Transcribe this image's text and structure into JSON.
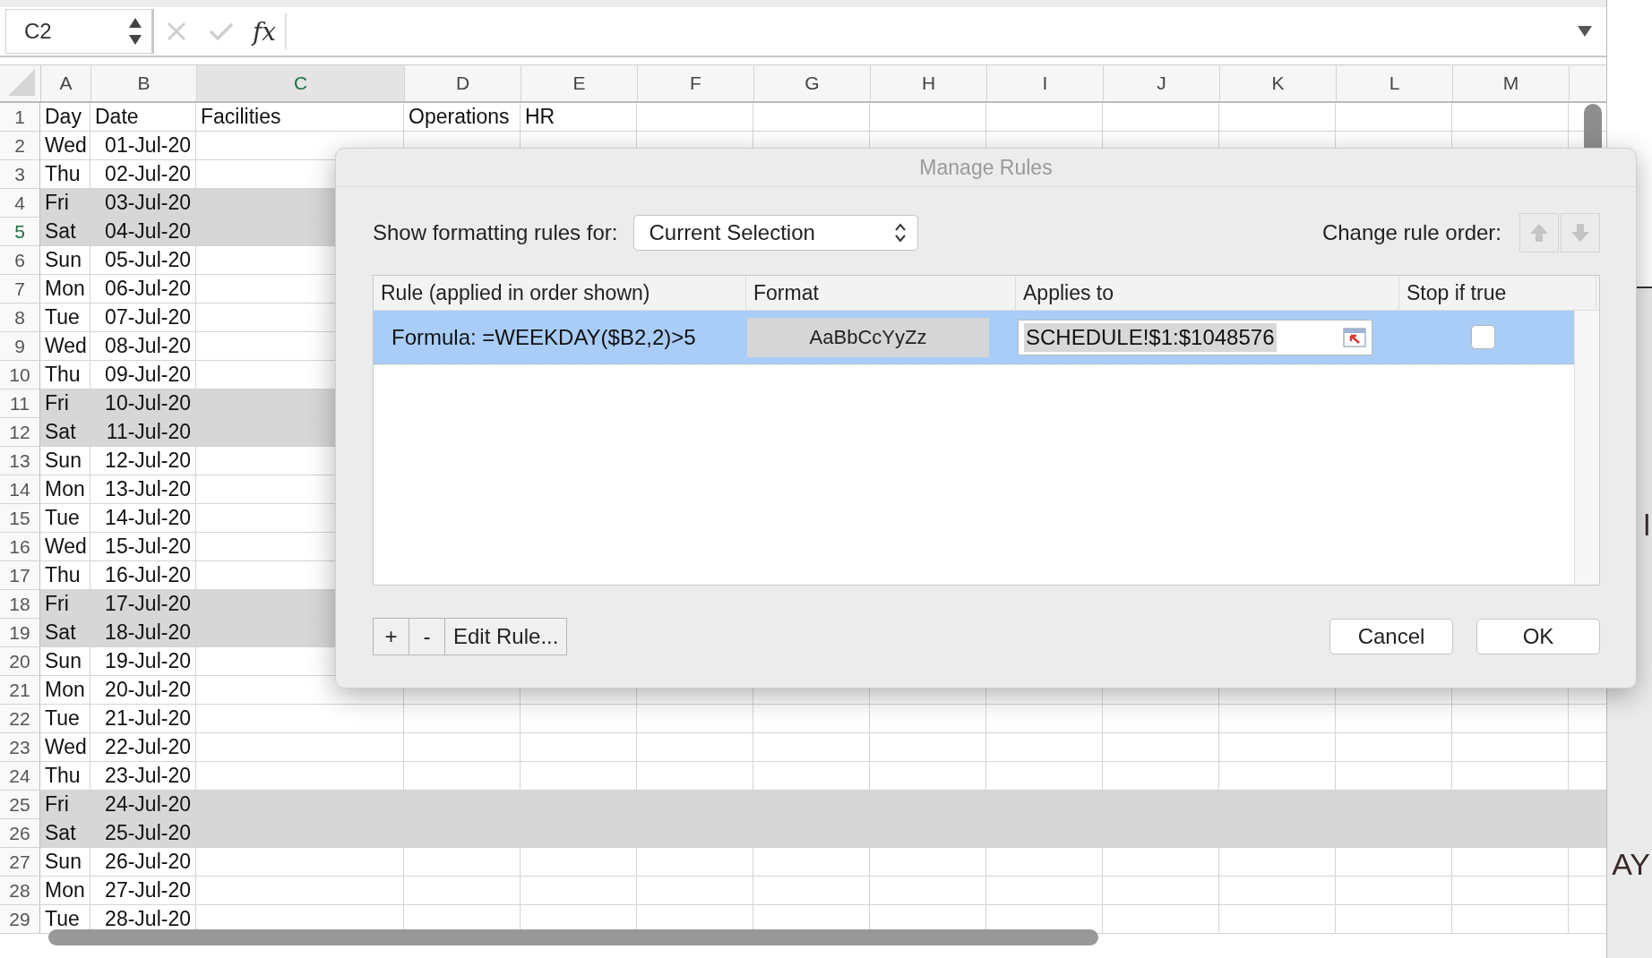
{
  "name_box": {
    "value": "C2"
  },
  "formula_bar": {
    "function_label": "fx"
  },
  "columns": [
    {
      "label": "A",
      "selected": false
    },
    {
      "label": "B",
      "selected": false
    },
    {
      "label": "C",
      "selected": true
    },
    {
      "label": "D",
      "selected": false
    },
    {
      "label": "E",
      "selected": false
    },
    {
      "label": "F",
      "selected": false
    },
    {
      "label": "G",
      "selected": false
    },
    {
      "label": "H",
      "selected": false
    },
    {
      "label": "I",
      "selected": false
    },
    {
      "label": "J",
      "selected": false
    },
    {
      "label": "K",
      "selected": false
    },
    {
      "label": "L",
      "selected": false
    },
    {
      "label": "M",
      "selected": false
    }
  ],
  "rows": [
    {
      "number": "1",
      "selected": false,
      "shaded": false,
      "cells": [
        "Day",
        "Date",
        "Facilities",
        "Operations",
        "HR"
      ]
    },
    {
      "number": "2",
      "selected": false,
      "shaded": false,
      "cells": [
        "Wed",
        "01-Jul-20"
      ]
    },
    {
      "number": "3",
      "selected": false,
      "shaded": false,
      "cells": [
        "Thu",
        "02-Jul-20"
      ]
    },
    {
      "number": "4",
      "selected": false,
      "shaded": true,
      "cells": [
        "Fri",
        "03-Jul-20"
      ]
    },
    {
      "number": "5",
      "selected": true,
      "shaded": true,
      "cells": [
        "Sat",
        "04-Jul-20"
      ]
    },
    {
      "number": "6",
      "selected": false,
      "shaded": false,
      "cells": [
        "Sun",
        "05-Jul-20"
      ]
    },
    {
      "number": "7",
      "selected": false,
      "shaded": false,
      "cells": [
        "Mon",
        "06-Jul-20"
      ]
    },
    {
      "number": "8",
      "selected": false,
      "shaded": false,
      "cells": [
        "Tue",
        "07-Jul-20"
      ]
    },
    {
      "number": "9",
      "selected": false,
      "shaded": false,
      "cells": [
        "Wed",
        "08-Jul-20"
      ]
    },
    {
      "number": "10",
      "selected": false,
      "shaded": false,
      "cells": [
        "Thu",
        "09-Jul-20"
      ]
    },
    {
      "number": "11",
      "selected": false,
      "shaded": true,
      "cells": [
        "Fri",
        "10-Jul-20"
      ]
    },
    {
      "number": "12",
      "selected": false,
      "shaded": true,
      "cells": [
        "Sat",
        "11-Jul-20"
      ]
    },
    {
      "number": "13",
      "selected": false,
      "shaded": false,
      "cells": [
        "Sun",
        "12-Jul-20"
      ]
    },
    {
      "number": "14",
      "selected": false,
      "shaded": false,
      "cells": [
        "Mon",
        "13-Jul-20"
      ]
    },
    {
      "number": "15",
      "selected": false,
      "shaded": false,
      "cells": [
        "Tue",
        "14-Jul-20"
      ]
    },
    {
      "number": "16",
      "selected": false,
      "shaded": false,
      "cells": [
        "Wed",
        "15-Jul-20"
      ]
    },
    {
      "number": "17",
      "selected": false,
      "shaded": false,
      "cells": [
        "Thu",
        "16-Jul-20"
      ]
    },
    {
      "number": "18",
      "selected": false,
      "shaded": true,
      "cells": [
        "Fri",
        "17-Jul-20"
      ]
    },
    {
      "number": "19",
      "selected": false,
      "shaded": true,
      "cells": [
        "Sat",
        "18-Jul-20"
      ]
    },
    {
      "number": "20",
      "selected": false,
      "shaded": false,
      "cells": [
        "Sun",
        "19-Jul-20"
      ]
    },
    {
      "number": "21",
      "selected": false,
      "shaded": false,
      "cells": [
        "Mon",
        "20-Jul-20"
      ]
    },
    {
      "number": "22",
      "selected": false,
      "shaded": false,
      "cells": [
        "Tue",
        "21-Jul-20"
      ]
    },
    {
      "number": "23",
      "selected": false,
      "shaded": false,
      "cells": [
        "Wed",
        "22-Jul-20"
      ]
    },
    {
      "number": "24",
      "selected": false,
      "shaded": false,
      "cells": [
        "Thu",
        "23-Jul-20"
      ]
    },
    {
      "number": "25",
      "selected": false,
      "shaded": true,
      "cells": [
        "Fri",
        "24-Jul-20"
      ]
    },
    {
      "number": "26",
      "selected": false,
      "shaded": true,
      "cells": [
        "Sat",
        "25-Jul-20"
      ]
    },
    {
      "number": "27",
      "selected": false,
      "shaded": false,
      "cells": [
        "Sun",
        "26-Jul-20"
      ]
    },
    {
      "number": "28",
      "selected": false,
      "shaded": false,
      "cells": [
        "Mon",
        "27-Jul-20"
      ]
    },
    {
      "number": "29",
      "selected": false,
      "shaded": false,
      "cells": [
        "Tue",
        "28-Jul-20"
      ]
    }
  ],
  "dialog": {
    "title": "Manage Rules",
    "filter_label": "Show formatting rules for:",
    "filter_value": "Current Selection",
    "order_label": "Change rule order:",
    "order_buttons": [
      {
        "kind": "up",
        "disabled": true
      },
      {
        "kind": "down",
        "disabled": true
      }
    ],
    "columns": [
      "Rule (applied in order shown)",
      "Format",
      "Applies to",
      "Stop if true"
    ],
    "rules": [
      {
        "rule": "Formula: =WEEKDAY($B2,2)>5",
        "format_sample": "AaBbCcYyZz",
        "applies_to": "SCHEDULE!$1:$1048576",
        "stop_if_true": false,
        "selected": true
      }
    ],
    "edit_buttons": [
      "+",
      "-",
      "Edit Rule..."
    ],
    "buttons": [
      "Cancel",
      "OK"
    ]
  },
  "background_window": {
    "texts": [
      "l",
      "AY"
    ]
  }
}
